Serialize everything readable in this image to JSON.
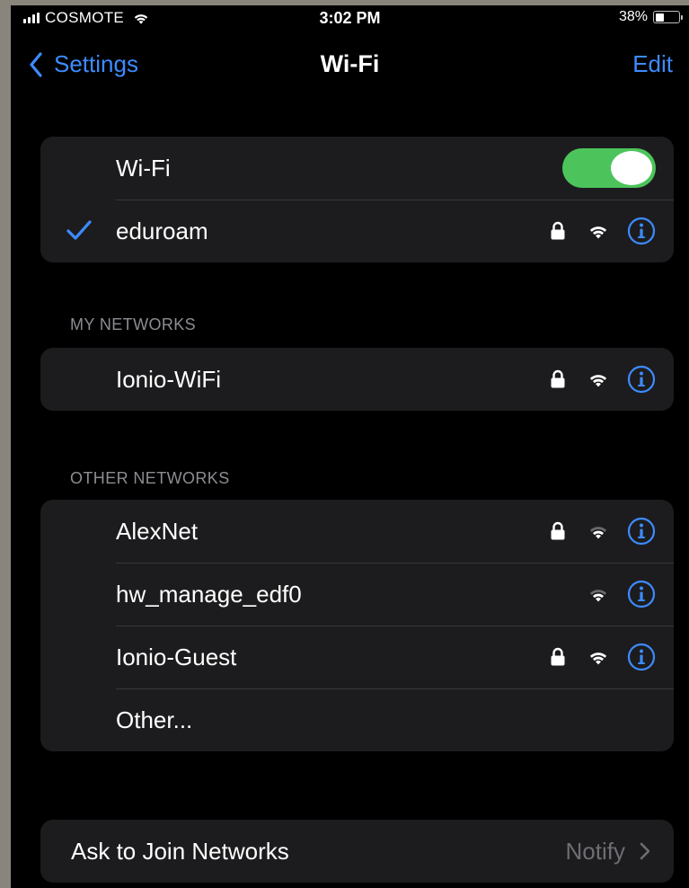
{
  "status_bar": {
    "carrier": "COSMOTE",
    "time": "3:02 PM",
    "battery": "38%",
    "battery_level": 0.38
  },
  "nav": {
    "back_label": "Settings",
    "title": "Wi-Fi",
    "edit_label": "Edit"
  },
  "wifi_toggle": {
    "label": "Wi-Fi",
    "enabled": true
  },
  "connected": {
    "name": "eduroam",
    "secured": true
  },
  "my_networks": {
    "header": "MY NETWORKS",
    "items": [
      {
        "name": "Ionio-WiFi",
        "secured": true
      }
    ]
  },
  "other_networks": {
    "header": "OTHER NETWORKS",
    "items": [
      {
        "name": "AlexNet",
        "secured": true
      },
      {
        "name": "hw_manage_edf0",
        "secured": false
      },
      {
        "name": "Ionio-Guest",
        "secured": true
      }
    ],
    "other_label": "Other..."
  },
  "ask_to_join": {
    "label": "Ask to Join Networks",
    "value": "Notify"
  },
  "colors": {
    "accent": "#3d8bff",
    "toggle_on": "#4cc45b",
    "cell_bg": "#1c1c1e",
    "background": "#000000"
  },
  "icons": [
    "signal-icon",
    "wifi-icon",
    "battery-icon",
    "chevron-left-icon",
    "checkmark-icon",
    "lock-icon",
    "info-icon",
    "chevron-right-icon"
  ]
}
